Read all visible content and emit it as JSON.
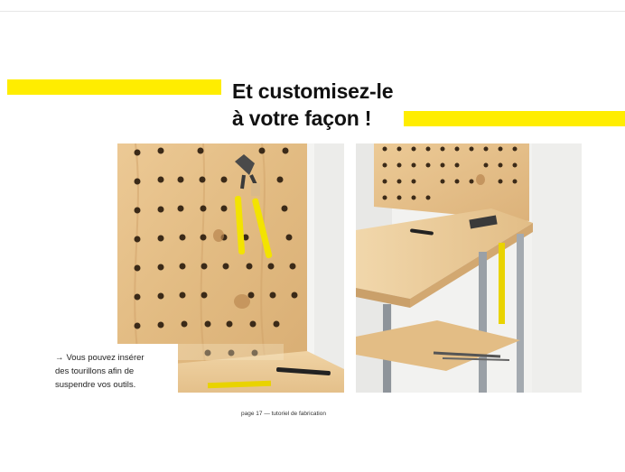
{
  "title": {
    "line1": "Et customisez-le",
    "line2": "à votre façon !"
  },
  "caption": {
    "arrow": "→",
    "line1": "Vous pouvez insérer",
    "line2": "des tourillons afin de",
    "line3": "suspendre vos outils."
  },
  "footer": {
    "text": "page 17 — tutoriel de fabrication"
  },
  "colors": {
    "accent": "#ffed00",
    "wood": "#e7c38e",
    "text": "#111111"
  },
  "photos": [
    {
      "name": "pegboard-with-pliers-photo"
    },
    {
      "name": "workbench-side-view-photo"
    }
  ]
}
